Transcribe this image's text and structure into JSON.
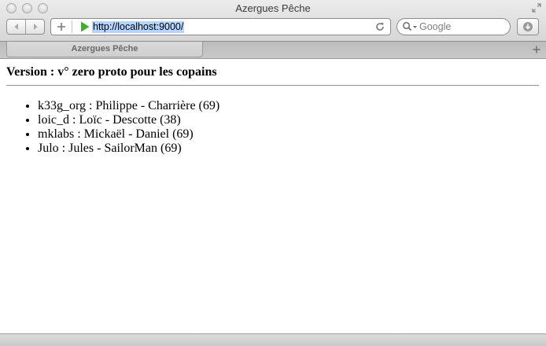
{
  "window": {
    "title": "Azergues Pêche"
  },
  "toolbar": {
    "back_icon": "back-arrow-icon",
    "forward_icon": "forward-arrow-icon",
    "add_bookmark_icon": "plus-icon",
    "url": "http://localhost:9000/",
    "reload_icon": "reload-icon",
    "search_placeholder": "Google",
    "download_icon": "download-icon"
  },
  "tabs": [
    {
      "label": "Azergues Pêche",
      "active": true
    }
  ],
  "page": {
    "heading": "Version : v° zero proto pour les copains",
    "people": [
      "k33g_org : Philippe - Charrière (69)",
      "loic_d : Loïc - Descotte (38)",
      "mklabs : Mickaël - Daniel (69)",
      "Julo : Jules - SailorMan (69)"
    ]
  },
  "colors": {
    "url_selection": "#b5d5ff",
    "play_icon_green": "#3fae2a"
  }
}
